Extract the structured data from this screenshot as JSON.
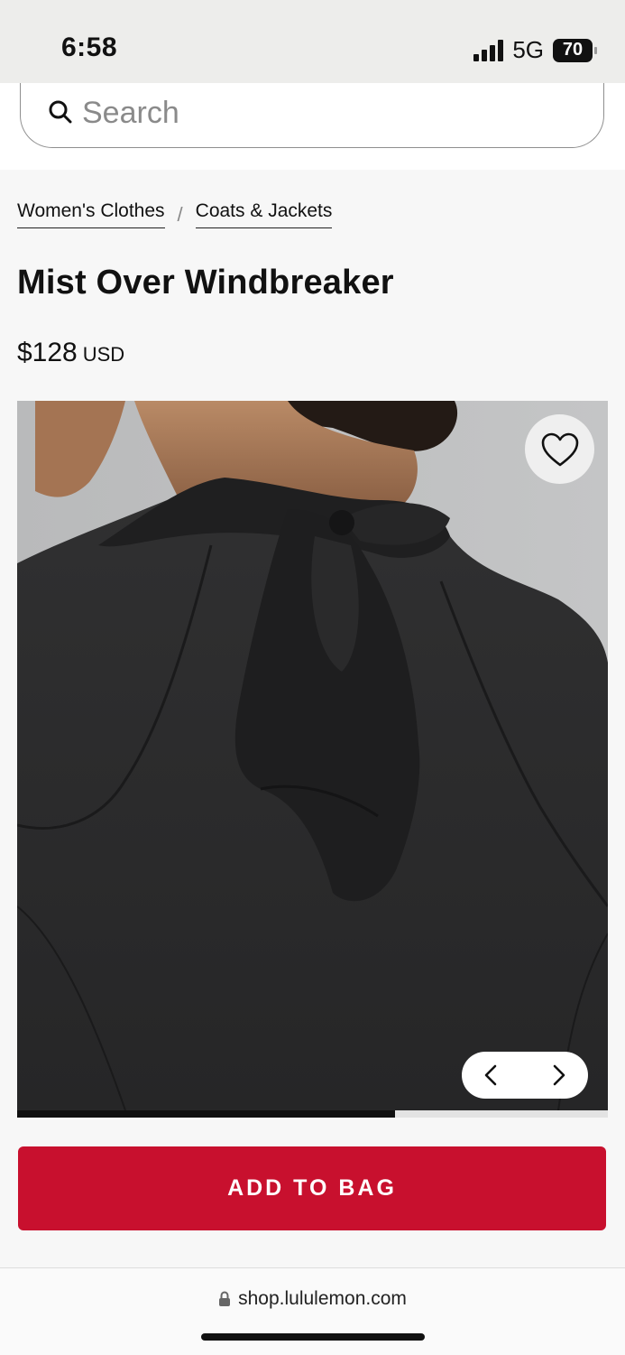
{
  "status_bar": {
    "time": "6:58",
    "network": "5G",
    "battery": "70"
  },
  "search": {
    "placeholder": "Search"
  },
  "breadcrumb": {
    "items": [
      "Women's Clothes",
      "Coats & Jackets"
    ],
    "separator": "/"
  },
  "product": {
    "title": "Mist Over Windbreaker",
    "price": "$128",
    "currency": "USD"
  },
  "gallery": {
    "progress_fraction": 0.64
  },
  "actions": {
    "add_to_bag": "ADD TO BAG"
  },
  "browser": {
    "url": "shop.lululemon.com"
  },
  "colors": {
    "accent": "#c8102e",
    "garment": "#2b2b2c"
  },
  "icons": [
    "search-icon",
    "heart-icon",
    "chevron-left-icon",
    "chevron-right-icon",
    "lock-icon"
  ]
}
